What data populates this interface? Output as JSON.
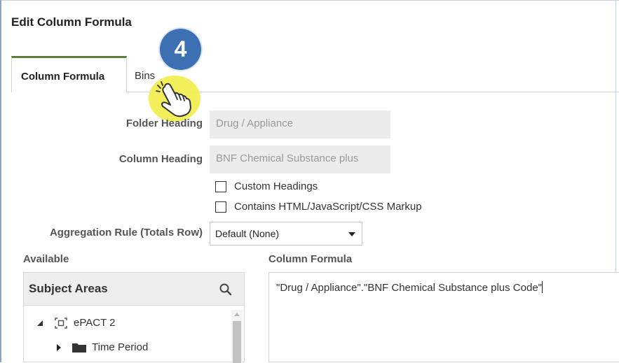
{
  "dialog": {
    "title": "Edit Column Formula"
  },
  "tabs": [
    {
      "label": "Column Formula",
      "active": true
    },
    {
      "label": "Bins",
      "active": false
    }
  ],
  "step_badge": "4",
  "form": {
    "folder_heading_label": "Folder Heading",
    "folder_heading_value": "Drug / Appliance",
    "column_heading_label": "Column Heading",
    "column_heading_value": "BNF Chemical Substance plus",
    "custom_headings_label": "Custom Headings",
    "contains_markup_label": "Contains HTML/JavaScript/CSS Markup",
    "aggregation_label": "Aggregation Rule (Totals Row)",
    "aggregation_value": "Default (None)"
  },
  "available": {
    "label": "Available",
    "panel_title": "Subject Areas",
    "tree": [
      {
        "label": "ePACT 2",
        "icon": "subject-area-icon",
        "expanded": true
      },
      {
        "label": "Time Period",
        "icon": "folder-icon",
        "expanded": false
      }
    ]
  },
  "formula": {
    "label": "Column Formula",
    "value": "\"Drug / Appliance\".\"BNF Chemical Substance plus Code\""
  },
  "colors": {
    "active_tab_accent": "#5a7f3a",
    "badge_blue": "#3d70b3",
    "highlight_yellow": "#f2ee4c"
  }
}
